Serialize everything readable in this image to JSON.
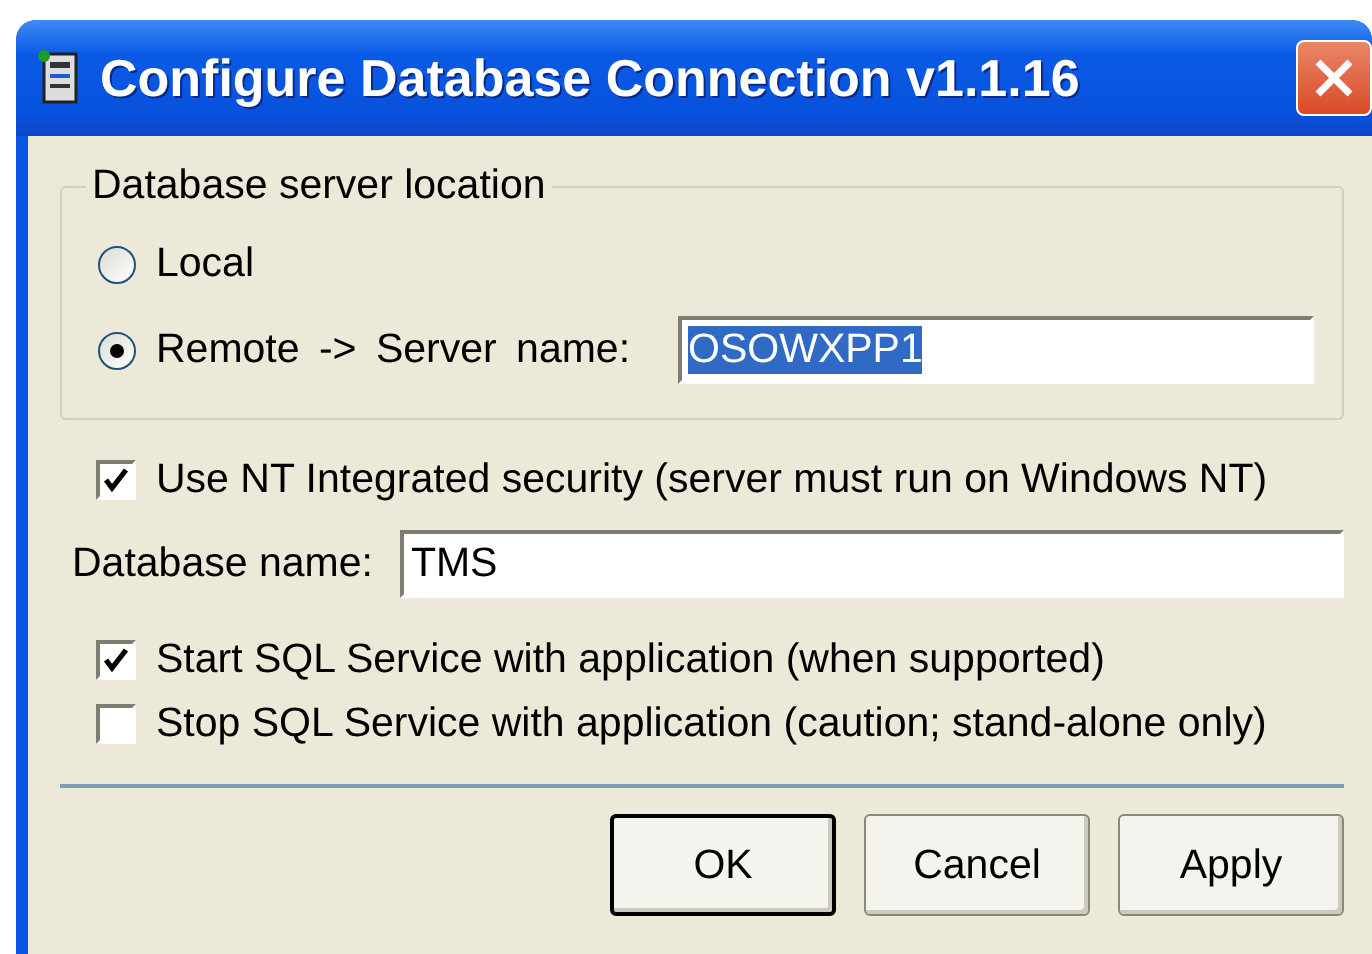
{
  "window": {
    "title": "Configure Database Connection v1.1.16"
  },
  "location_group": {
    "title": "Database server location",
    "options": [
      {
        "kind": "plain",
        "label": "Local",
        "selected": false
      },
      {
        "kind": "with_field",
        "label": "Remote -> Server name:",
        "selected": true,
        "field": {
          "value": "OSOWXPP1",
          "text_selected": true
        }
      }
    ]
  },
  "checkboxes_top": [
    {
      "label": "Use NT Integrated security (server must run on Windows NT)",
      "checked": true
    }
  ],
  "database_name": {
    "label": "Database name:",
    "value": "TMS"
  },
  "checkboxes_bottom": [
    {
      "label": "Start SQL Service with application (when supported)",
      "checked": true
    },
    {
      "label": "Stop SQL Service with application (caution; stand-alone only)",
      "checked": false
    }
  ],
  "buttons": [
    {
      "label": "OK",
      "default": true
    },
    {
      "label": "Cancel",
      "default": false
    },
    {
      "label": "Apply",
      "default": false
    }
  ]
}
